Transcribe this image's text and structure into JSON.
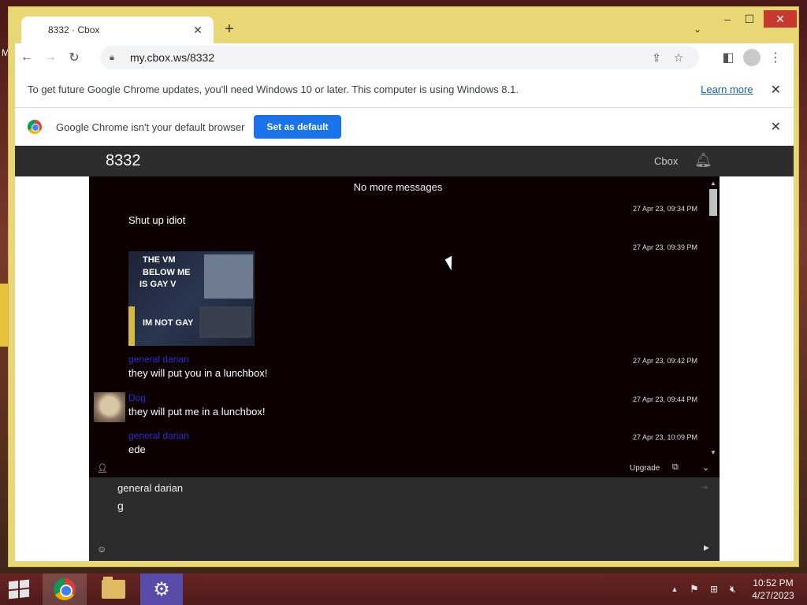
{
  "desktop": {
    "left_letter": "M"
  },
  "browser": {
    "tab_title": "8332 · Cbox",
    "tab_close": "✕",
    "new_tab": "+",
    "url": "my.cbox.ws/8332",
    "update_notice": "To get future Google Chrome updates, you'll need Windows 10 or later. This computer is using Windows 8.1.",
    "learn_more": "Learn more",
    "default_notice": "Google Chrome isn't your default browser",
    "set_default": "Set as default",
    "close_x": "✕"
  },
  "cbox": {
    "room_title": "8332",
    "brand": "Cbox",
    "no_more": "No more messages",
    "messages": [
      {
        "time": "27 Apr 23, 09:34 PM",
        "name": "",
        "text": "Shut up idiot"
      },
      {
        "time": "27 Apr 23, 09:39 PM",
        "name": "",
        "text": ""
      },
      {
        "time": "27 Apr 23, 09:42 PM",
        "name": "general darian",
        "text": "they will put you in a lunchbox!"
      },
      {
        "time": "27 Apr 23, 09:44 PM",
        "name": "Dog",
        "text": "they will put me in a lunchbox!"
      },
      {
        "time": "27 Apr 23, 10:09 PM",
        "name": "general darian",
        "text": "ede"
      }
    ],
    "meme_lines": {
      "line1": "THE VM",
      "line2": "BELOW ME",
      "line3": "IS GAY V",
      "line4": "IM NOT GAY"
    },
    "upgrade": "Upgrade",
    "compose_name": "general darian",
    "compose_value": "g"
  },
  "taskbar": {
    "time": "10:52 PM",
    "date": "4/27/2023"
  },
  "colors": {
    "window_frame": "#e8d774",
    "chat_bg": "#0d0000",
    "username": "#2b2bd4",
    "set_default_btn": "#1a73e8",
    "close_button": "#c7392f"
  }
}
